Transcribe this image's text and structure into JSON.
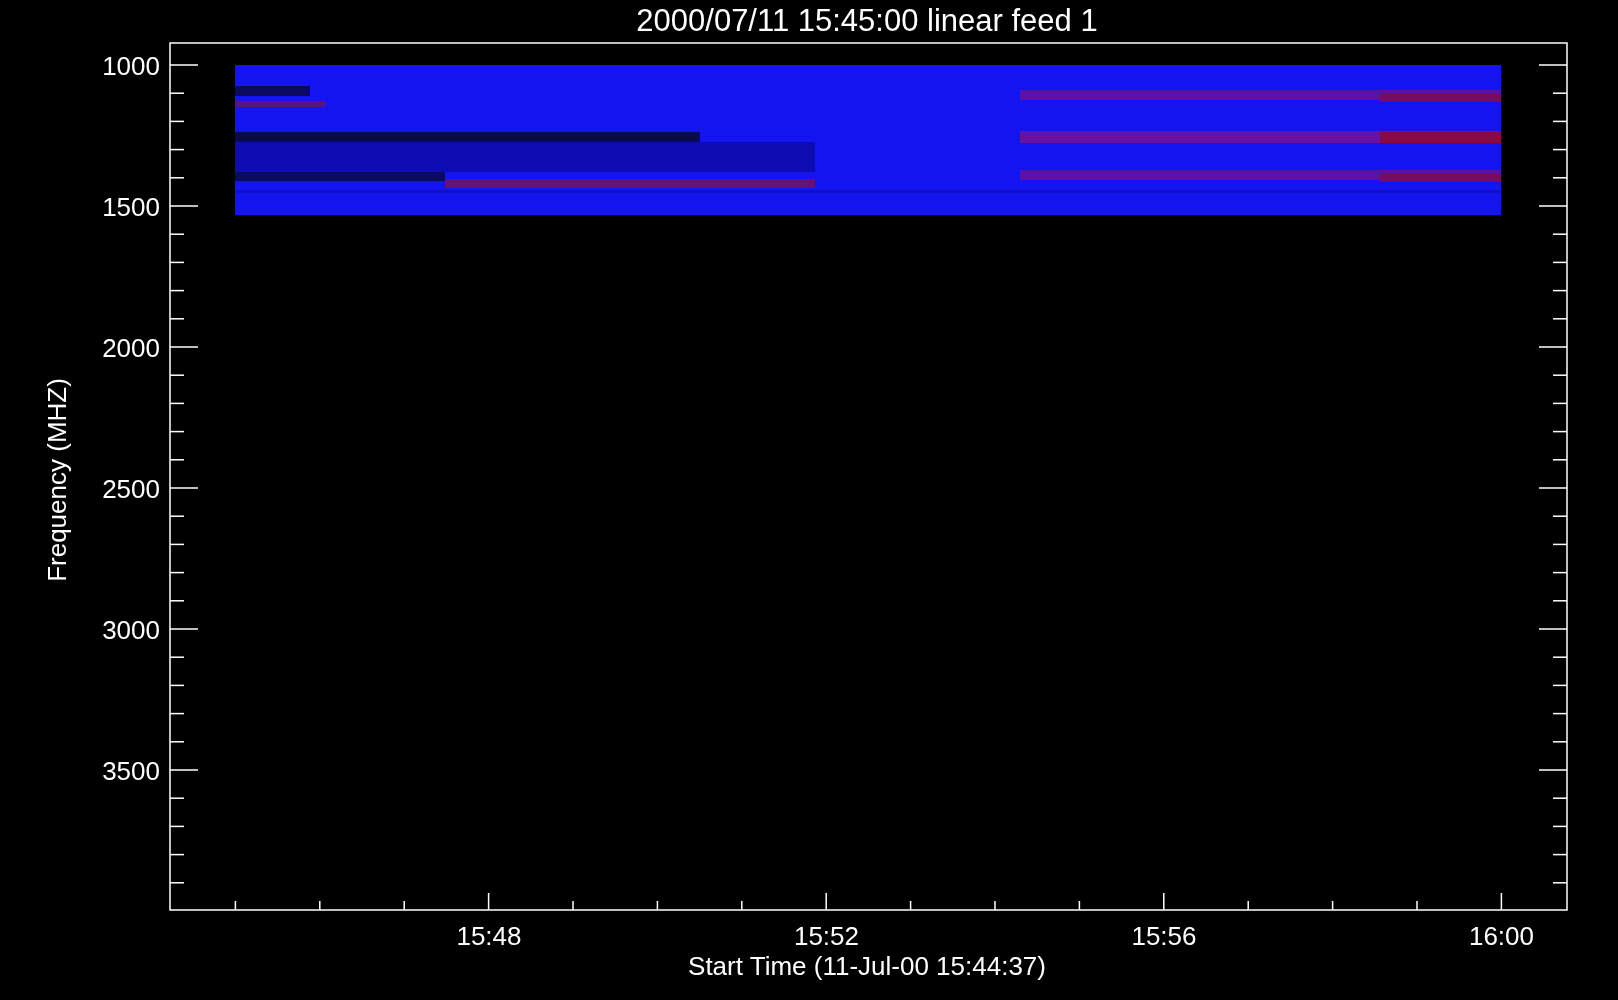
{
  "title": "2000/07/11 15:45:00 linear feed 1",
  "ylabel": "Frequency (MHZ)",
  "xlabel": "Start Time (11-Jul-00 15:44:37)",
  "yticks": [
    "1000",
    "1500",
    "2000",
    "2500",
    "3000",
    "3500"
  ],
  "xticks": [
    "15:48",
    "15:52",
    "15:56",
    "16:00"
  ]
}
